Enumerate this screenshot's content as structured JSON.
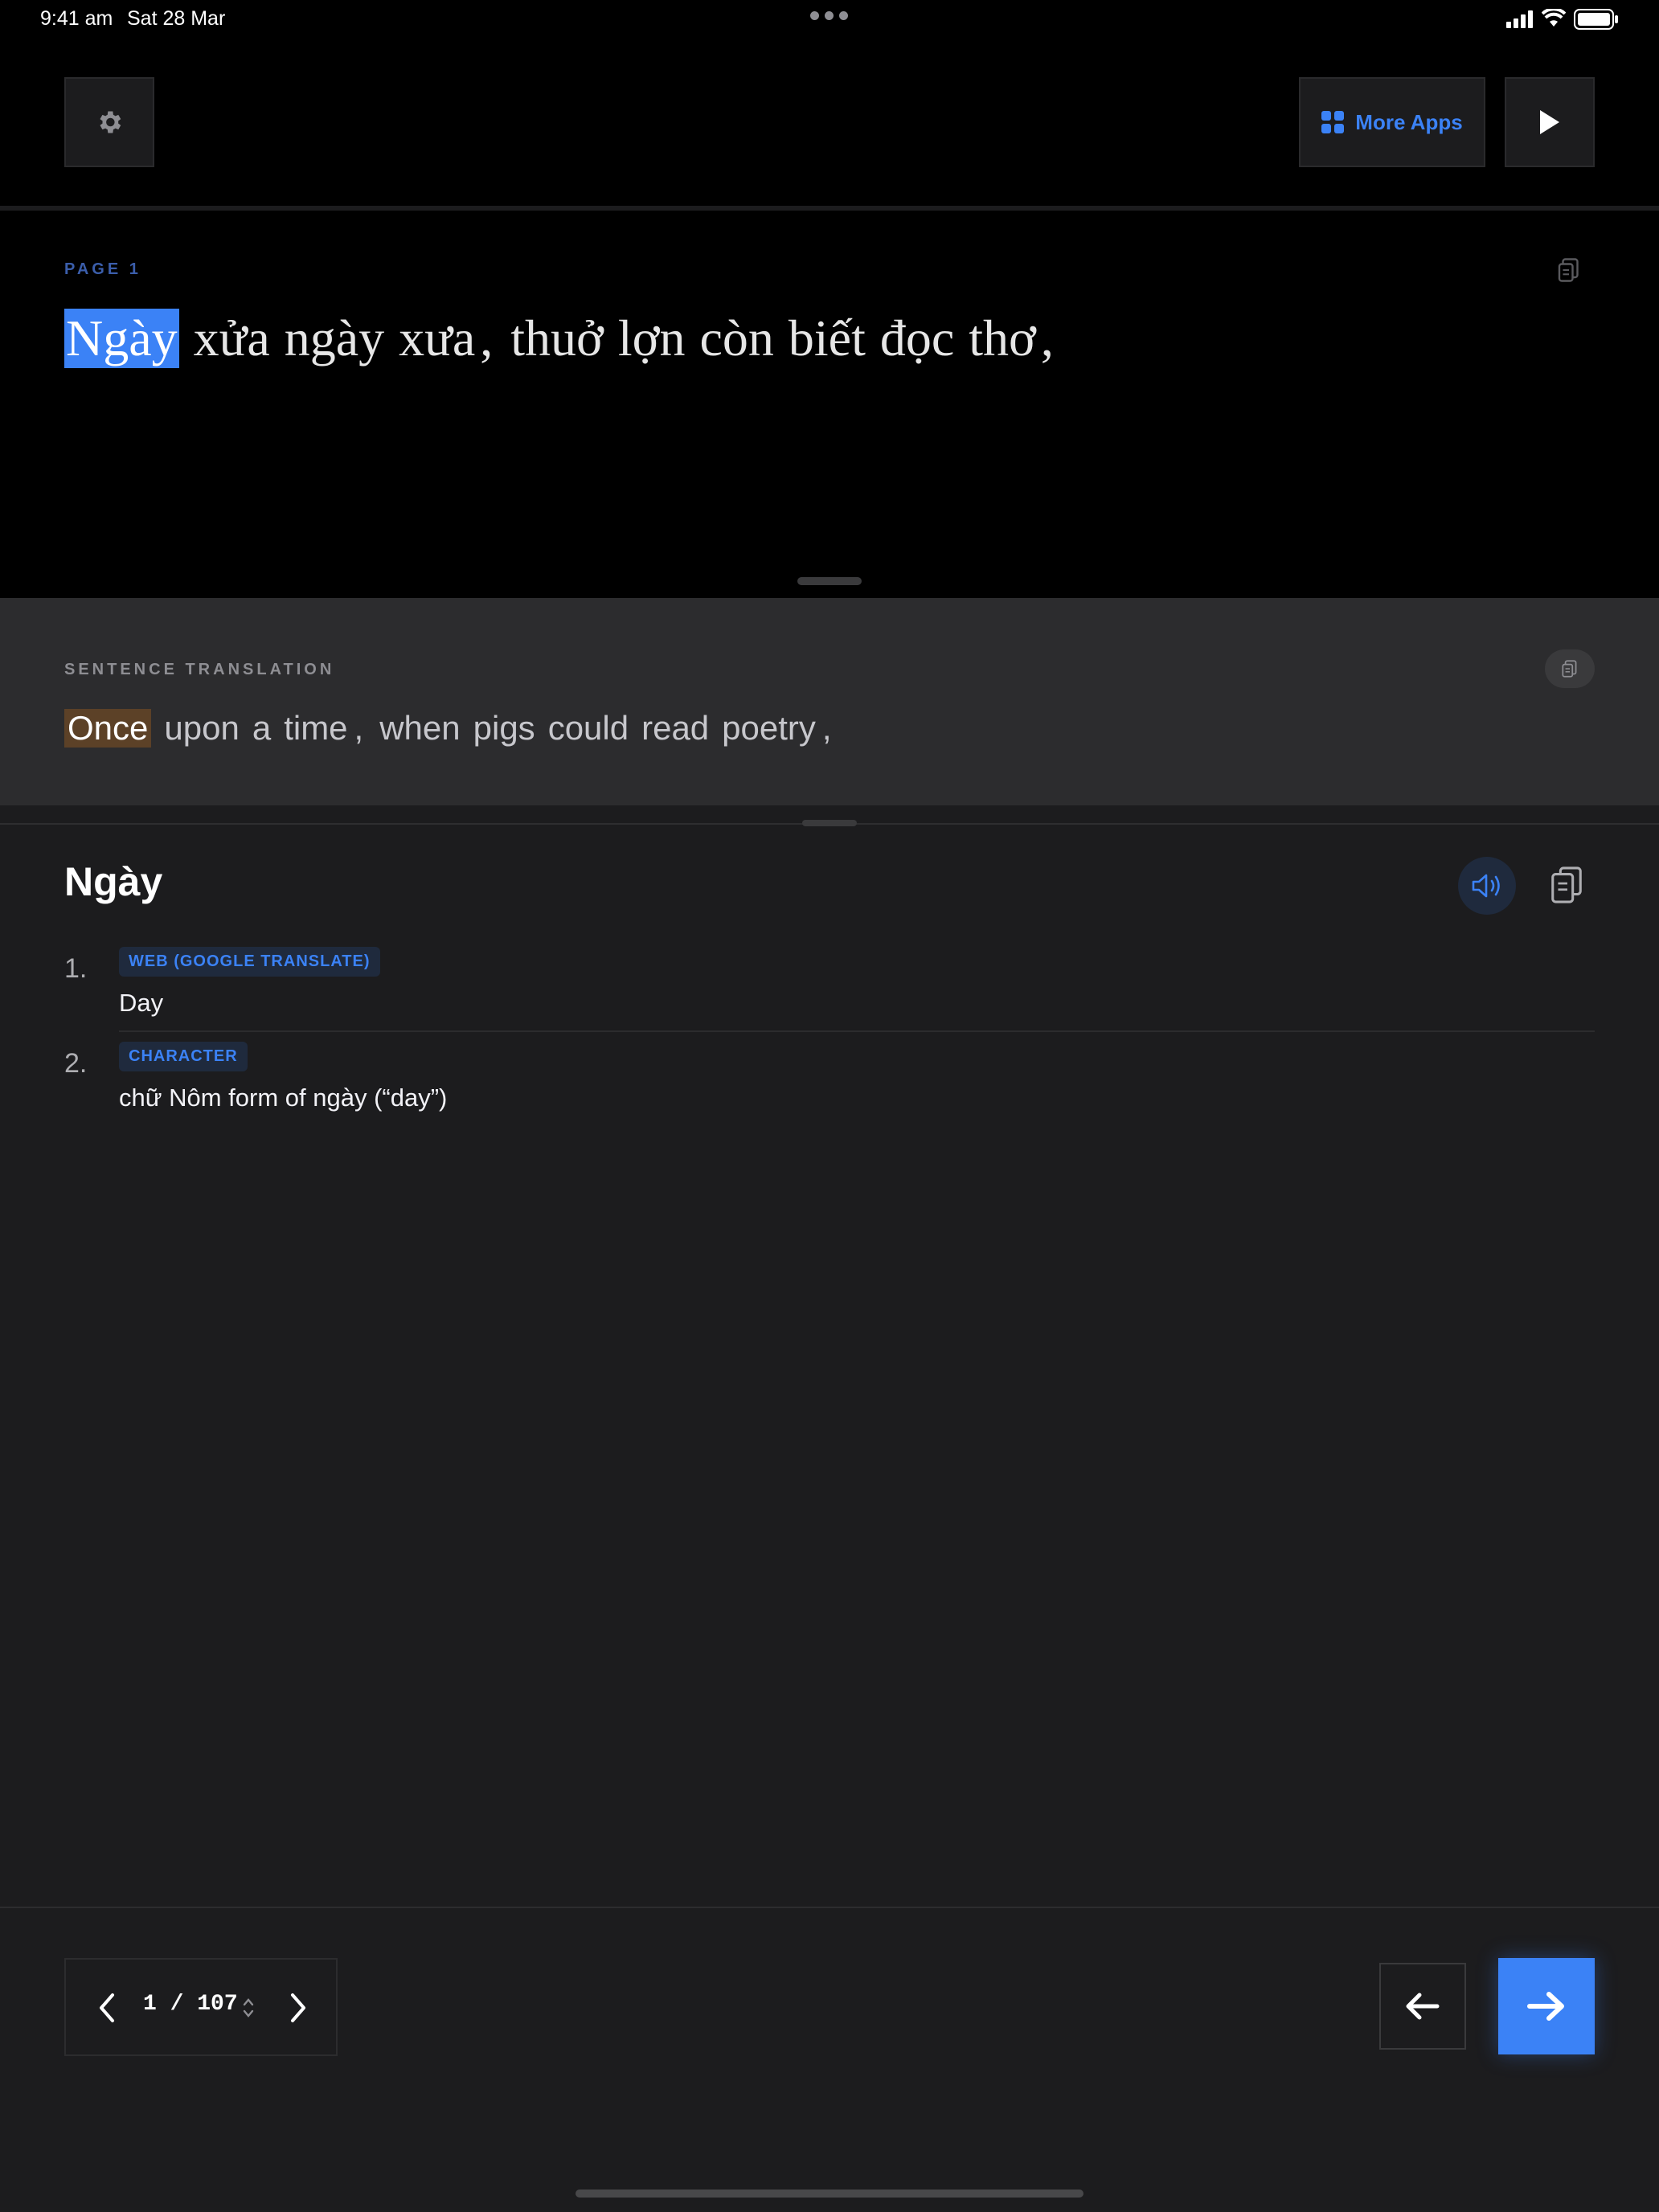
{
  "status_bar": {
    "time": "9:41 am",
    "date": "Sat 28 Mar"
  },
  "toolbar": {
    "settings_icon": "gear-icon",
    "more_apps_label": "More Apps",
    "more_apps_icon": "grid-icon",
    "play_icon": "play-icon"
  },
  "page": {
    "label": "PAGE 1",
    "source_words": [
      "Ngày",
      "xửa",
      "ngày",
      "xưa",
      ",",
      "thuở",
      "lợn",
      "còn",
      "biết",
      "đọc",
      "thơ",
      ","
    ],
    "highlighted_index": 0
  },
  "translation": {
    "label": "SENTENCE TRANSLATION",
    "words": [
      "Once",
      "upon",
      "a",
      "time",
      ",",
      "when",
      "pigs",
      "could",
      "read",
      "poetry",
      ","
    ],
    "highlighted_index": 0
  },
  "dictionary": {
    "word": "Ngày",
    "entries": [
      {
        "number": "1.",
        "tag": "WEB (GOOGLE TRANSLATE)",
        "text": "Day"
      },
      {
        "number": "2.",
        "tag": "CHARACTER",
        "text": "chữ Nôm form of ngày (“day”)"
      }
    ]
  },
  "pager": {
    "current": "1",
    "separator": "/",
    "total": "107"
  },
  "colors": {
    "accent": "#3b82f6",
    "highlight_source": "#3b82f6",
    "highlight_translation": "#5c4127",
    "background": "#1c1c1e"
  }
}
